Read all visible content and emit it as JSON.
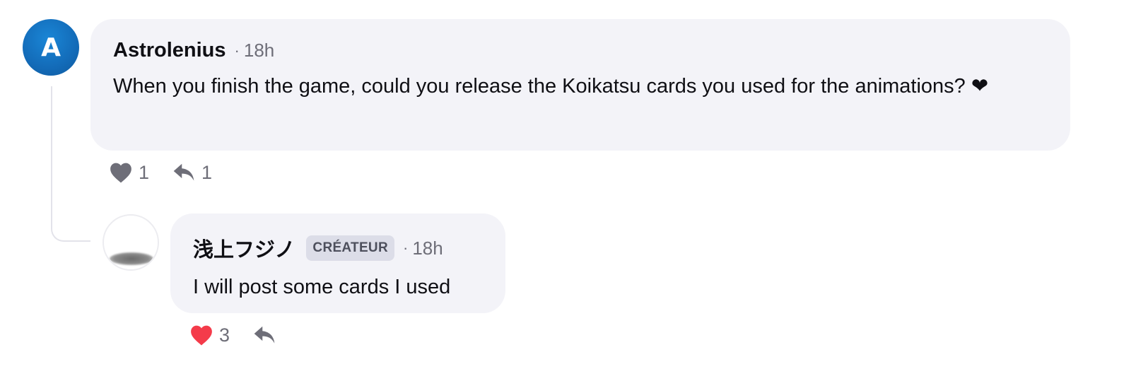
{
  "comment": {
    "author_initial": "A",
    "author": "Astrolenius",
    "separator": "·",
    "time": "18h",
    "text": "When you finish the game, could you release the Koikatsu cards you used for the animations? ❤",
    "like_count": "1",
    "reply_count": "1",
    "like_icon": "heart-icon",
    "reply_icon": "reply-arrow-icon",
    "like_color": "#6e6e78",
    "avatar_color": "#136bb8"
  },
  "reply": {
    "author": "浅上フジノ",
    "badge": "CRÉATEUR",
    "separator": "·",
    "time": "18h",
    "text": "I will post some cards I used",
    "like_count": "3",
    "like_icon": "heart-icon",
    "reply_icon": "reply-arrow-icon",
    "like_color": "#f43b4a"
  }
}
